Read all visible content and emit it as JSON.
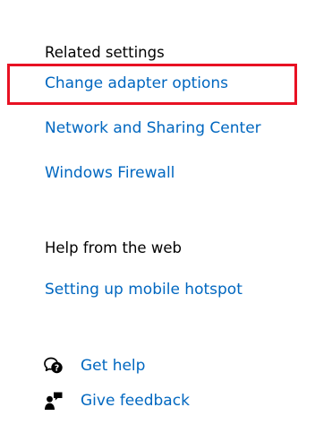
{
  "related_settings": {
    "heading": "Related settings",
    "links": [
      "Change adapter options",
      "Network and Sharing Center",
      "Windows Firewall"
    ]
  },
  "help_from_web": {
    "heading": "Help from the web",
    "links": [
      "Setting up mobile hotspot"
    ]
  },
  "support": {
    "get_help": {
      "label": "Get help",
      "icon": "get-help-icon"
    },
    "give_feedback": {
      "label": "Give feedback",
      "icon": "feedback-icon"
    }
  },
  "colors": {
    "link": "#0067c0",
    "text": "#000000",
    "highlight": "#e81123",
    "background": "#ffffff"
  }
}
